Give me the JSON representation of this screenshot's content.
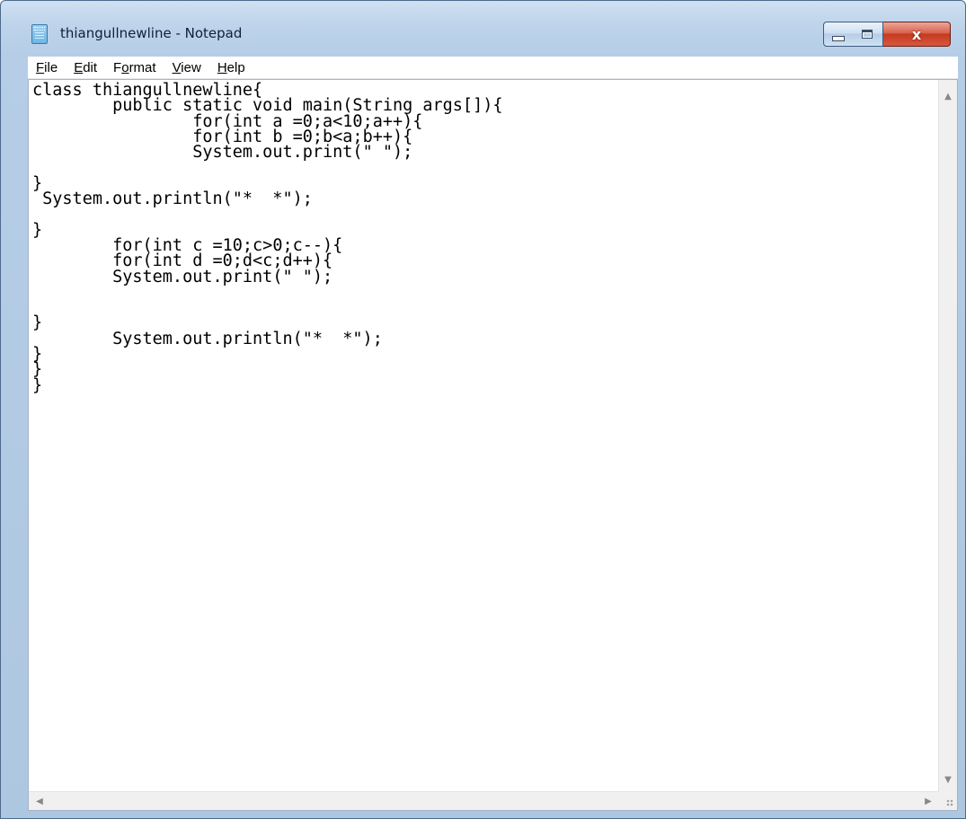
{
  "window": {
    "title": "thiangullnewline - Notepad",
    "app_icon": "notepad-icon",
    "controls": {
      "minimize": "minimize-icon",
      "maximize": "maximize-icon",
      "close": "close-icon"
    },
    "close_glyph": "x"
  },
  "menu": [
    {
      "pre": "",
      "mnemonic": "F",
      "post": "ile"
    },
    {
      "pre": "",
      "mnemonic": "E",
      "post": "dit"
    },
    {
      "pre": "F",
      "mnemonic": "o",
      "post": "rmat"
    },
    {
      "pre": "",
      "mnemonic": "V",
      "post": "iew"
    },
    {
      "pre": "",
      "mnemonic": "H",
      "post": "elp"
    }
  ],
  "editor": {
    "content": "class thiangullnewline{\n\tpublic static void main(String args[]){\n\t\tfor(int a =0;a<10;a++){\n\t\tfor(int b =0;b<a;b++){\n\t\tSystem.out.print(\" \");\n\n}\n System.out.println(\"*  *\");\n\n}\n\tfor(int c =10;c>0;c--){\n\tfor(int d =0;d<c;d++){\n\tSystem.out.print(\" \");\n\n\n}\n\tSystem.out.println(\"*  *\");\n}\n}\n}"
  },
  "scrollbars": {
    "up_arrow": "▲",
    "down_arrow": "▼",
    "left_arrow": "◀",
    "right_arrow": "▶"
  }
}
